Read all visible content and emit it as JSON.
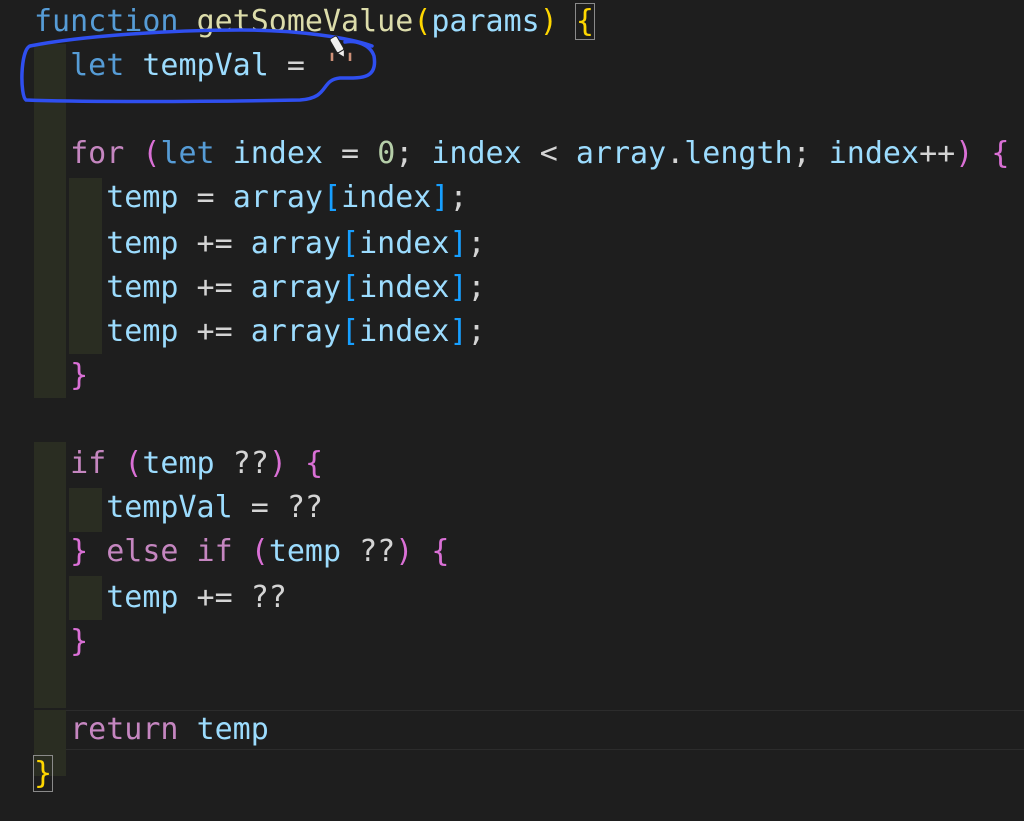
{
  "editor": {
    "colors": {
      "background": "#1e1e1e",
      "keyword": "#c586c0",
      "declaration": "#569cd6",
      "function": "#dcdcaa",
      "variable": "#9cdcfe",
      "number": "#b5cea8",
      "annotation": "#2f4ff0"
    },
    "annotation_icon": "pen-cursor-icon",
    "lines": [
      [
        [
          "decl",
          "function"
        ],
        [
          "op",
          " "
        ],
        [
          "fn",
          "getSomeValue"
        ],
        [
          "brace-y",
          "("
        ],
        [
          "var",
          "params"
        ],
        [
          "brace-y",
          ")"
        ],
        [
          "op",
          " "
        ],
        [
          "brace-y box",
          "{"
        ]
      ],
      [
        [
          "op",
          "  "
        ],
        [
          "decl",
          "let"
        ],
        [
          "op",
          " "
        ],
        [
          "var",
          "tempVal"
        ],
        [
          "op",
          " = "
        ],
        [
          "str",
          "''"
        ]
      ],
      [],
      [
        [
          "op",
          "  "
        ],
        [
          "kw",
          "for"
        ],
        [
          "op",
          " "
        ],
        [
          "brace-p",
          "("
        ],
        [
          "decl",
          "let"
        ],
        [
          "op",
          " "
        ],
        [
          "var",
          "index"
        ],
        [
          "op",
          " = "
        ],
        [
          "num",
          "0"
        ],
        [
          "op",
          "; "
        ],
        [
          "var",
          "index"
        ],
        [
          "op",
          " < "
        ],
        [
          "var",
          "array"
        ],
        [
          "op",
          "."
        ],
        [
          "var",
          "length"
        ],
        [
          "op",
          "; "
        ],
        [
          "var",
          "index"
        ],
        [
          "op",
          "++"
        ],
        [
          "brace-p",
          ")"
        ],
        [
          "op",
          " "
        ],
        [
          "brace-p",
          "{"
        ]
      ],
      [
        [
          "op",
          "    "
        ],
        [
          "var",
          "temp"
        ],
        [
          "op",
          " = "
        ],
        [
          "var",
          "array"
        ],
        [
          "brace-b",
          "["
        ],
        [
          "var",
          "index"
        ],
        [
          "brace-b",
          "]"
        ],
        [
          "op",
          ";"
        ]
      ],
      [
        [
          "op",
          "    "
        ],
        [
          "var",
          "temp"
        ],
        [
          "op",
          " += "
        ],
        [
          "var",
          "array"
        ],
        [
          "brace-b",
          "["
        ],
        [
          "var",
          "index"
        ],
        [
          "brace-b",
          "]"
        ],
        [
          "op",
          ";"
        ]
      ],
      [
        [
          "op",
          "    "
        ],
        [
          "var",
          "temp"
        ],
        [
          "op",
          " += "
        ],
        [
          "var",
          "array"
        ],
        [
          "brace-b",
          "["
        ],
        [
          "var",
          "index"
        ],
        [
          "brace-b",
          "]"
        ],
        [
          "op",
          ";"
        ]
      ],
      [
        [
          "op",
          "    "
        ],
        [
          "var",
          "temp"
        ],
        [
          "op",
          " += "
        ],
        [
          "var",
          "array"
        ],
        [
          "brace-b",
          "["
        ],
        [
          "var",
          "index"
        ],
        [
          "brace-b",
          "]"
        ],
        [
          "op",
          ";"
        ]
      ],
      [
        [
          "op",
          "  "
        ],
        [
          "brace-p",
          "}"
        ]
      ],
      [],
      [
        [
          "op",
          "  "
        ],
        [
          "kw",
          "if"
        ],
        [
          "op",
          " "
        ],
        [
          "brace-p",
          "("
        ],
        [
          "var",
          "temp"
        ],
        [
          "op",
          " ??"
        ],
        [
          "brace-p",
          ")"
        ],
        [
          "op",
          " "
        ],
        [
          "brace-p",
          "{"
        ]
      ],
      [
        [
          "op",
          "    "
        ],
        [
          "var",
          "tempVal"
        ],
        [
          "op",
          " = ??"
        ]
      ],
      [
        [
          "op",
          "  "
        ],
        [
          "brace-p",
          "}"
        ],
        [
          "op",
          " "
        ],
        [
          "kw",
          "else if"
        ],
        [
          "op",
          " "
        ],
        [
          "brace-p",
          "("
        ],
        [
          "var",
          "temp"
        ],
        [
          "op",
          " ??"
        ],
        [
          "brace-p",
          ")"
        ],
        [
          "op",
          " "
        ],
        [
          "brace-p",
          "{"
        ]
      ],
      [
        [
          "op",
          "    "
        ],
        [
          "var",
          "temp"
        ],
        [
          "op",
          " += ??"
        ]
      ],
      [
        [
          "op",
          "  "
        ],
        [
          "brace-p",
          "}"
        ]
      ],
      [],
      [
        [
          "op",
          "  "
        ],
        [
          "kw",
          "return"
        ],
        [
          "op",
          " "
        ],
        [
          "var",
          "temp"
        ]
      ],
      [
        [
          "brace-y box",
          "}"
        ]
      ]
    ]
  }
}
